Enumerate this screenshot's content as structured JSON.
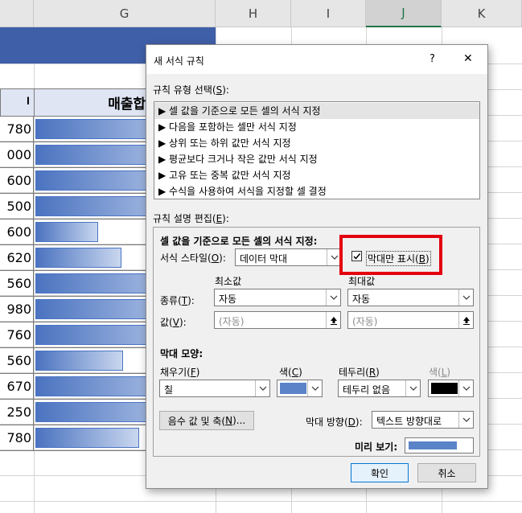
{
  "sheet": {
    "columns": [
      "G",
      "H",
      "I",
      "J",
      "K"
    ],
    "header_cell_left": "ᅵ",
    "header_cell_main": "매출합계",
    "values": [
      "780",
      "000",
      "600",
      "500",
      "600",
      "620",
      "560",
      "980",
      "760",
      "560",
      "670",
      "250",
      "780"
    ],
    "bar_fractions": [
      1,
      1,
      1,
      1,
      0.35,
      0.48,
      1,
      1,
      1,
      0.49,
      1,
      1,
      0.58
    ],
    "bar_color": "#4b73c0"
  },
  "dialog": {
    "title": "새 서식 규칙",
    "help_label": "?",
    "close_label": "✕",
    "rule_type_label": "규칙 유형 선택(",
    "rule_type_key": "S",
    "rule_types": [
      "▶ 셀 값을 기준으로 모든 셀의 서식 지정",
      "▶ 다음을 포함하는 셀만 서식 지정",
      "▶ 상위 또는 하위 값만 서식 지정",
      "▶ 평균보다 크거나 작은 값만 서식 지정",
      "▶ 고유 또는 중복 값만 서식 지정",
      "▶ 수식을 사용하여 서식을 지정할 셀 결정"
    ],
    "edit_label": "규칙 설명 편집(",
    "edit_key": "E",
    "format_all_label": "셀 값을 기준으로 모든 셀의 서식 지정:",
    "format_style_label": "서식 스타일(",
    "format_style_key": "O",
    "format_style_value": "데이터 막대",
    "show_bar_only_label": "막대만 표시(",
    "show_bar_only_key": "B",
    "min_label": "최소값",
    "max_label": "최대값",
    "type_label": "종류(",
    "type_key": "T",
    "type_min_value": "자동",
    "type_max_value": "자동",
    "value_label": "값(",
    "value_key": "V",
    "value_min_placeholder": "(자동)",
    "value_max_placeholder": "(자동)",
    "bar_appearance_label": "막대 모양:",
    "fill_label": "채우기(",
    "fill_key": "F",
    "fill_value": "칠",
    "color_label": "색(",
    "color_key": "C",
    "fill_color": "#5b84c8",
    "border_label": "테두리(",
    "border_key": "R",
    "border_value": "테두리 없음",
    "border_color_label": "색(",
    "border_color_key": "L",
    "border_color": "#000000",
    "negative_btn_label": "음수 값 및 축(",
    "negative_btn_key": "N",
    "direction_label": "막대 방향(",
    "direction_key": "D",
    "direction_value": "텍스트 방향대로",
    "preview_label": "미리 보기:",
    "ok_label": "확인",
    "cancel_label": "취소",
    "highlight_color": "#e3000f"
  }
}
